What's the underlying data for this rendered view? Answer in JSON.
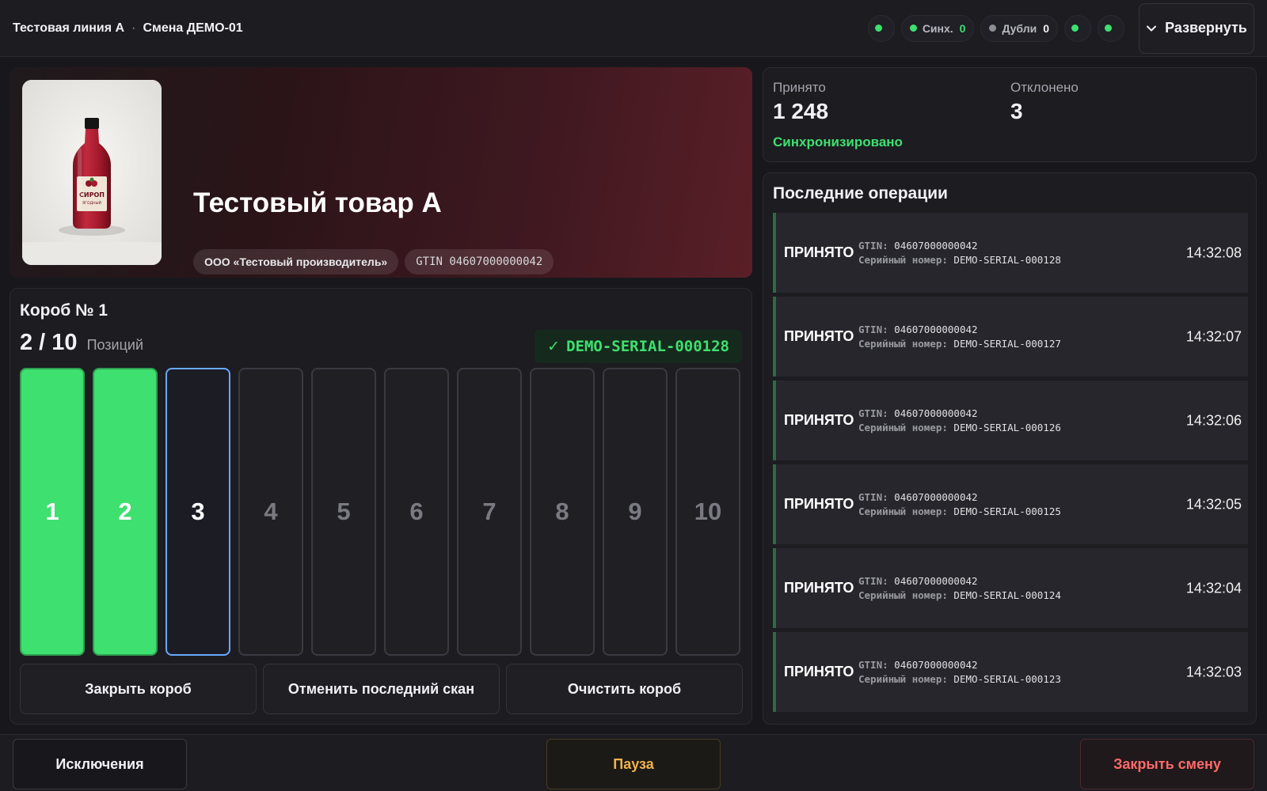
{
  "header": {
    "line": "Тестовая линия А",
    "separator": "·",
    "shift": "Смена ДЕМО-01",
    "sync": {
      "label": "Синх.",
      "count": "0"
    },
    "duplicates": {
      "label": "Дубли",
      "count": "0"
    },
    "expand_label": "Развернуть",
    "colors": {
      "ok": "#3ee06f",
      "neutral": "#8e8e96"
    }
  },
  "product": {
    "name": "Тестовый товар А",
    "manufacturer": "ООО «Тестовый производитель»",
    "gtin": "GTIN 04607000000042",
    "image_label_main": "СИРОП",
    "image_label_sub": "ЯГОДНЫЙ"
  },
  "box": {
    "title": "Короб № 1",
    "count": "2 / 10",
    "count_label": "Позиций",
    "last_serial": "DEMO-SERIAL-000128",
    "check_mark": "✓",
    "slots": [
      {
        "n": "1",
        "state": "done"
      },
      {
        "n": "2",
        "state": "done"
      },
      {
        "n": "3",
        "state": "current"
      },
      {
        "n": "4",
        "state": "empty"
      },
      {
        "n": "5",
        "state": "empty"
      },
      {
        "n": "6",
        "state": "empty"
      },
      {
        "n": "7",
        "state": "empty"
      },
      {
        "n": "8",
        "state": "empty"
      },
      {
        "n": "9",
        "state": "empty"
      },
      {
        "n": "10",
        "state": "empty"
      }
    ],
    "actions": {
      "close_box": "Закрыть короб",
      "undo_scan": "Отменить последний скан",
      "clear_box": "Очистить короб"
    }
  },
  "stats": {
    "accepted_label": "Принято",
    "accepted_value": "1 248",
    "rejected_label": "Отклонено",
    "rejected_value": "3",
    "sync_status": "Синхронизировано"
  },
  "operations": {
    "title": "Последние операции",
    "gtin_key": "GTIN:",
    "serial_key": "Серийный номер:",
    "items": [
      {
        "status": "ПРИНЯТО",
        "gtin": "04607000000042",
        "serial": "DEMO-SERIAL-000128",
        "time": "14:32:08"
      },
      {
        "status": "ПРИНЯТО",
        "gtin": "04607000000042",
        "serial": "DEMO-SERIAL-000127",
        "time": "14:32:07"
      },
      {
        "status": "ПРИНЯТО",
        "gtin": "04607000000042",
        "serial": "DEMO-SERIAL-000126",
        "time": "14:32:06"
      },
      {
        "status": "ПРИНЯТО",
        "gtin": "04607000000042",
        "serial": "DEMO-SERIAL-000125",
        "time": "14:32:05"
      },
      {
        "status": "ПРИНЯТО",
        "gtin": "04607000000042",
        "serial": "DEMO-SERIAL-000124",
        "time": "14:32:04"
      },
      {
        "status": "ПРИНЯТО",
        "gtin": "04607000000042",
        "serial": "DEMO-SERIAL-000123",
        "time": "14:32:03"
      }
    ]
  },
  "footer": {
    "exceptions": "Исключения",
    "pause": "Пауза",
    "close_shift": "Закрыть смену"
  }
}
